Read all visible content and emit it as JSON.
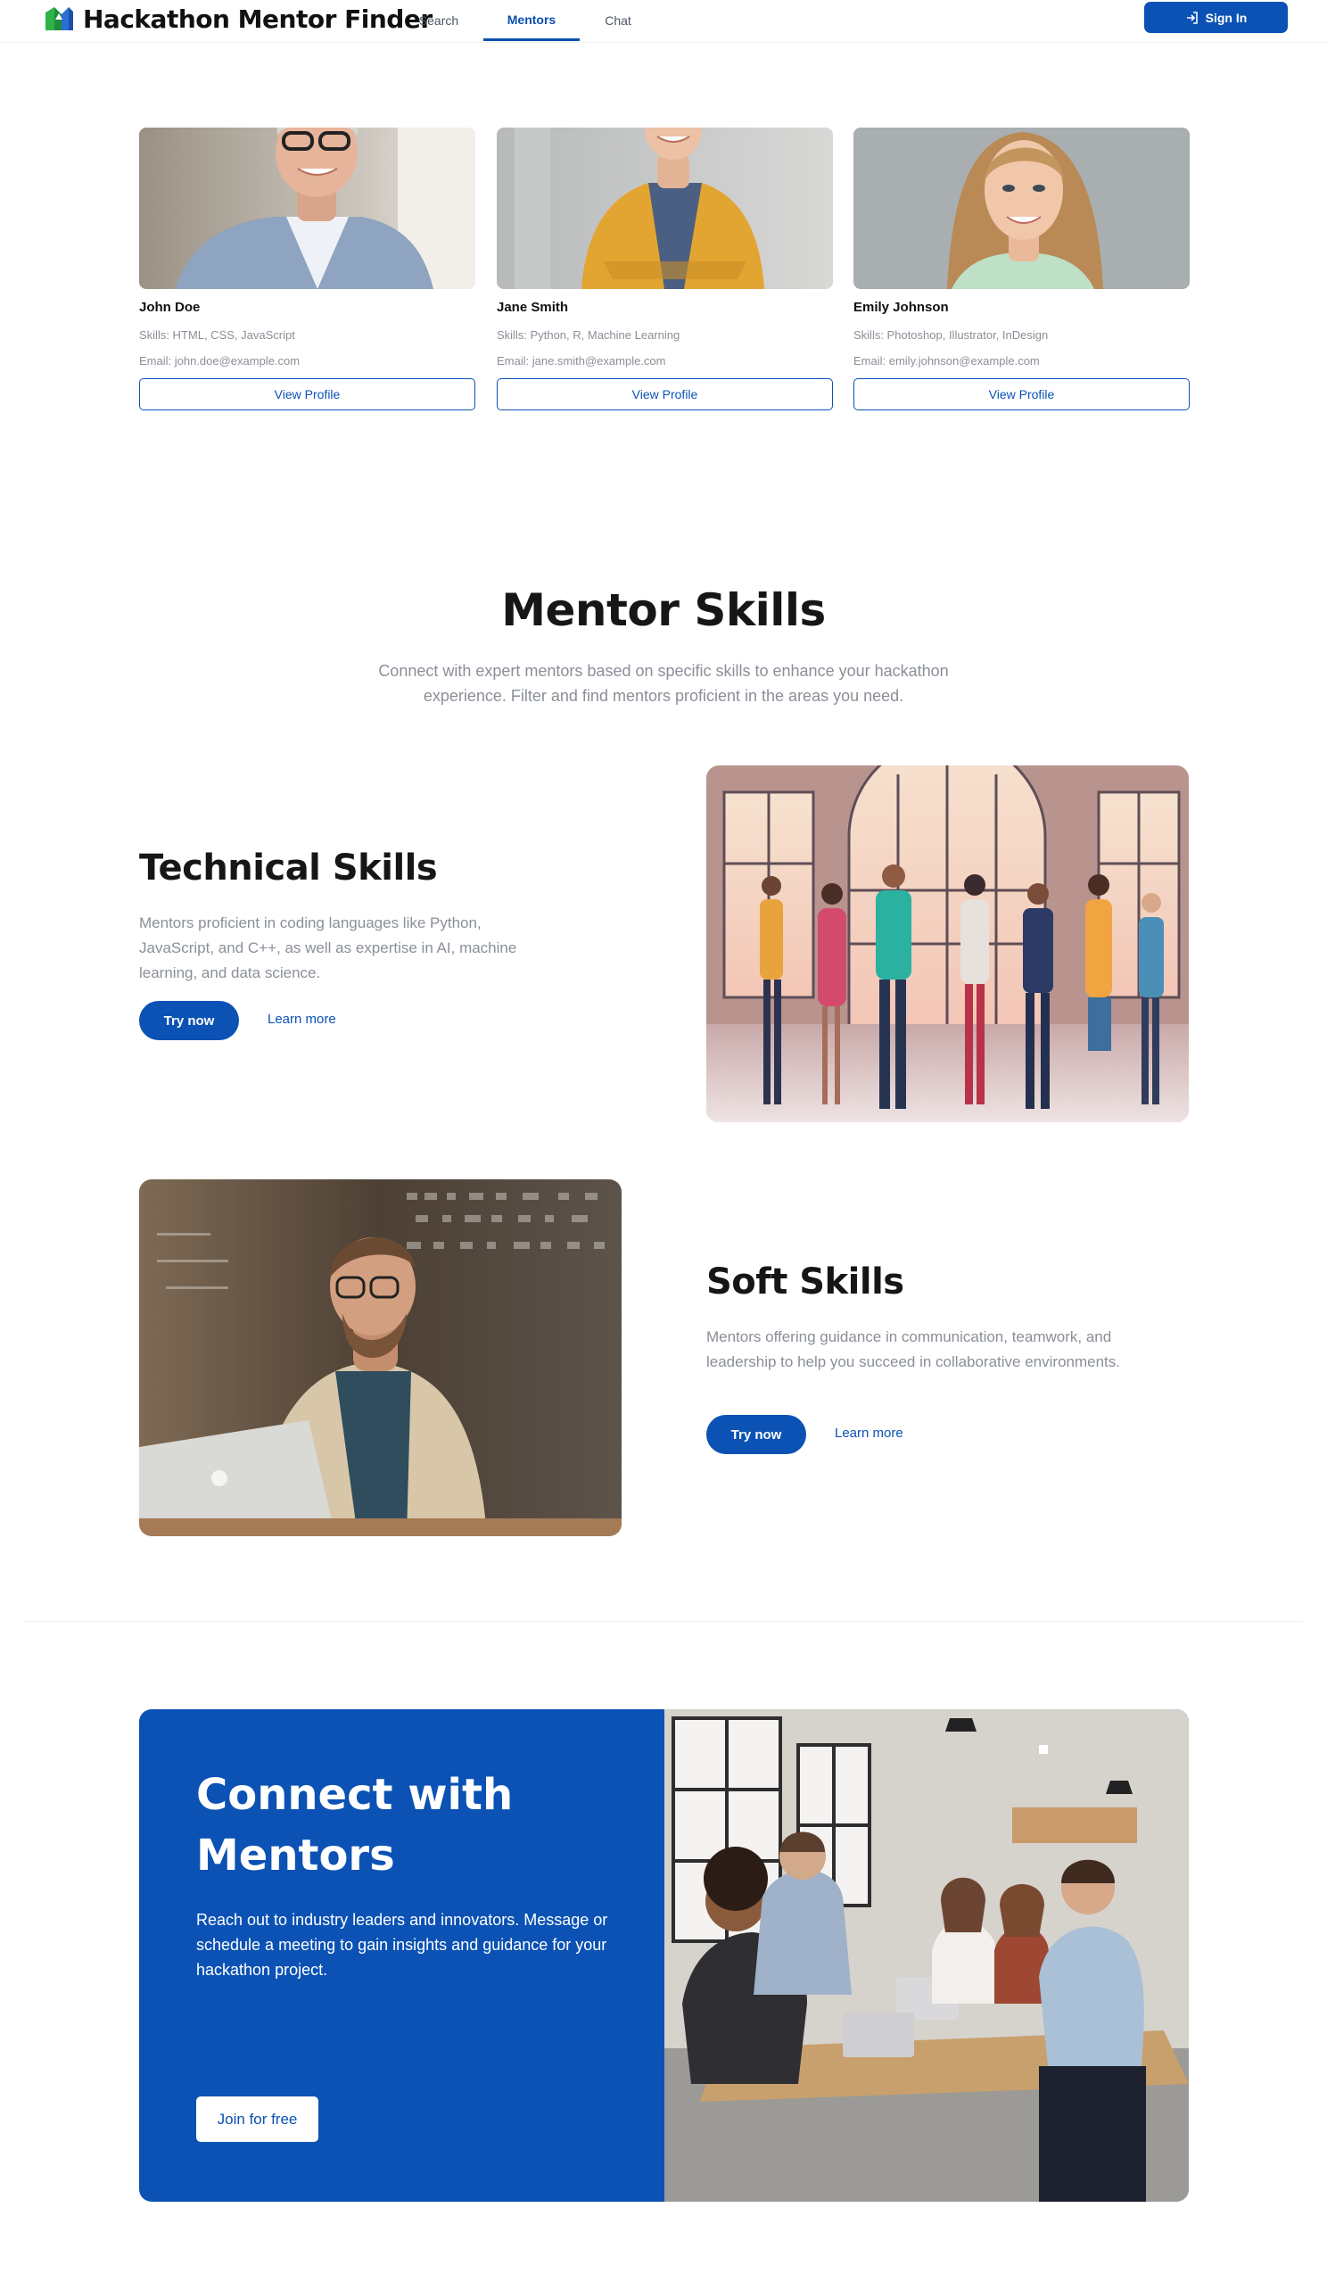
{
  "header": {
    "app_title": "Hackathon Mentor Finder",
    "nav": [
      "Search",
      "Mentors",
      "Chat"
    ],
    "active_tab": "Mentors",
    "signin_label": "Sign In"
  },
  "mentors": [
    {
      "name": "John Doe",
      "skills": "Skills: HTML, CSS, JavaScript",
      "email": "Email: john.doe@example.com",
      "button": "View Profile"
    },
    {
      "name": "Jane Smith",
      "skills": "Skills: Python, R, Machine Learning",
      "email": "Email: jane.smith@example.com",
      "button": "View Profile"
    },
    {
      "name": "Emily Johnson",
      "skills": "Skills: Photoshop, Illustrator, InDesign",
      "email": "Email: emily.johnson@example.com",
      "button": "View Profile"
    }
  ],
  "skills_section": {
    "title": "Mentor Skills",
    "subtitle": "Connect with expert mentors based on specific skills to enhance your hackathon experience. Filter and find mentors proficient in the areas you need.",
    "technical": {
      "title": "Technical Skills",
      "text": "Mentors proficient in coding languages like Python, JavaScript, and C++, as well as expertise in AI, machine learning, and data science.",
      "try_label": "Try now",
      "learn_label": "Learn more"
    },
    "soft": {
      "title": "Soft Skills",
      "text": "Mentors offering guidance in communication, teamwork, and leadership to help you succeed in collaborative environments.",
      "try_label": "Try now",
      "learn_label": "Learn more"
    }
  },
  "cta": {
    "title": "Connect with Mentors",
    "text": "Reach out to industry leaders and innovators. Message or schedule a meeting to gain insights and guidance for your hackathon project.",
    "button": "Join for free"
  },
  "colors": {
    "brand": "#0b52b4",
    "muted_text": "#8a8f98",
    "heading": "#161616"
  }
}
